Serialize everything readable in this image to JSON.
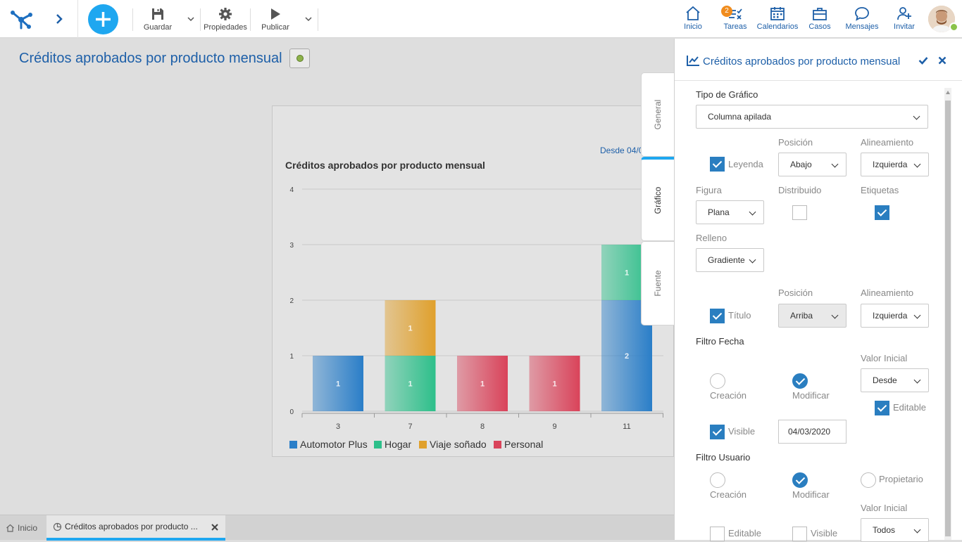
{
  "toolbar": {
    "guardar": "Guardar",
    "propiedades": "Propiedades",
    "publicar": "Publicar"
  },
  "nav": {
    "inicio": "Inicio",
    "tareas": "Tareas",
    "tareas_badge": "2",
    "calendarios": "Calendarios",
    "casos": "Casos",
    "mensajes": "Mensajes",
    "invitar": "Invitar"
  },
  "page": {
    "title": "Créditos aprobados por producto mensual"
  },
  "chart_data": {
    "type": "bar",
    "stacked": true,
    "title": "Créditos aprobados por producto mensual",
    "date_label": "Desde 04/0",
    "categories": [
      "3",
      "7",
      "8",
      "9",
      "11"
    ],
    "ylim": [
      0,
      4
    ],
    "yticks": [
      "0",
      "1",
      "2",
      "3",
      "4"
    ],
    "legend_position": "bottom-left",
    "series": [
      {
        "name": "Automotor Plus",
        "color": "#2a7ec8",
        "values": [
          1,
          0,
          0,
          0,
          2
        ]
      },
      {
        "name": "Hogar",
        "color": "#2dbf8a",
        "values": [
          0,
          1,
          0,
          0,
          1
        ]
      },
      {
        "name": "Viaje soñado",
        "color": "#e0a02c",
        "values": [
          0,
          1,
          0,
          0,
          0
        ]
      },
      {
        "name": "Personal",
        "color": "#d9435a",
        "values": [
          0,
          0,
          1,
          1,
          0
        ]
      }
    ]
  },
  "bottom_tabs": {
    "inicio": "Inicio",
    "active": "Créditos aprobados por producto ..."
  },
  "panel": {
    "title": "Créditos aprobados por producto mensual",
    "tabs": {
      "general": "General",
      "grafico": "Gráfico",
      "fuente": "Fuente"
    },
    "tipo_grafico_label": "Tipo de Gráfico",
    "tipo_grafico_value": "Columna apilada",
    "posicion_label": "Posición",
    "alineamiento_label": "Alineamiento",
    "leyenda_label": "Leyenda",
    "leyenda_posicion": "Abajo",
    "leyenda_alineamiento": "Izquierda",
    "figura_label": "Figura",
    "figura_value": "Plana",
    "distribuido_label": "Distribuido",
    "etiquetas_label": "Etiquetas",
    "relleno_label": "Relleno",
    "relleno_value": "Gradiente",
    "titulo_label": "Título",
    "titulo_posicion": "Arriba",
    "titulo_alineamiento": "Izquierda",
    "filtro_fecha_label": "Filtro Fecha",
    "valor_inicial_label": "Valor Inicial",
    "valor_inicial_fecha": "Desde",
    "creacion_label": "Creación",
    "modificar_label": "Modificar",
    "editable_label": "Editable",
    "visible_label": "Visible",
    "fecha_value": "04/03/2020",
    "filtro_usuario_label": "Filtro Usuario",
    "propietario_label": "Propietario",
    "valor_inicial_usuario": "Todos"
  }
}
